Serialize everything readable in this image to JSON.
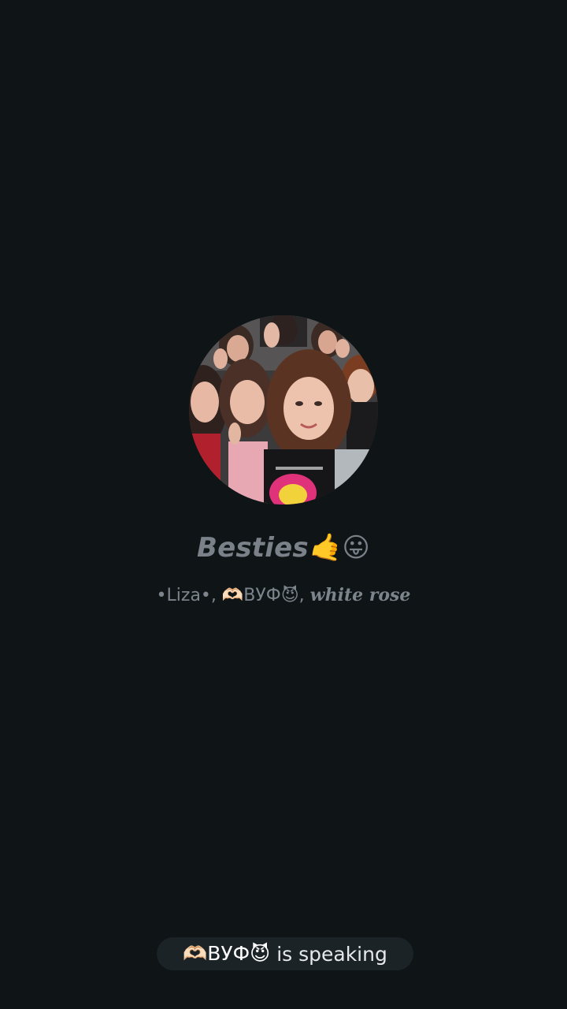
{
  "group": {
    "title": "Besties🤙😛"
  },
  "members": {
    "member1": "•Liza•",
    "separator1": ", ",
    "member2": "🫶🏻ВУФ😈",
    "separator2": ", ",
    "member3": "white rose"
  },
  "status": {
    "speaker": "🫶🏻ВУФ😈",
    "suffix": " is speaking"
  },
  "colors": {
    "background": "#0f1417",
    "pill": "#1c2327",
    "muted_text": "#7a8189"
  }
}
